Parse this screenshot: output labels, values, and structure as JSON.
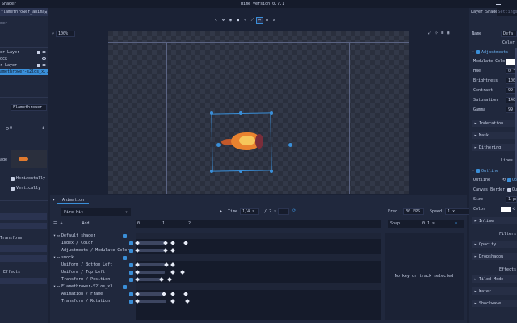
{
  "app": {
    "title": "Mime version 0.7.1"
  },
  "left_panel": {
    "tab": "Shader",
    "doc_tab": "flamethrower_animatio...",
    "sub_label": "der",
    "layers": [
      {
        "name": "er Layer"
      },
      {
        "name": "ock"
      },
      {
        "name": "r Layer"
      },
      {
        "name": "amethrower-s2los_x..."
      }
    ],
    "texture_name": "Flamethrower-S2#",
    "frame_value": "0",
    "flip_horizontal": "Horizontally",
    "flip_vertical": "Vertically",
    "transform_label": "Transform",
    "effects_label": "Effects"
  },
  "viewport": {
    "zoom": "100%"
  },
  "timeline": {
    "tab": "Animation",
    "clip_name": "Fire hit",
    "time_label": "Time",
    "time_value": "1/4 s",
    "time_total": "/ 2 s",
    "fps_label": "Freq.",
    "fps_value": "30 FPS",
    "speed_label": "Speed",
    "speed_value": "1 x",
    "add_label": "Add",
    "snap_label": "Snap",
    "snap_value": "0.1 s",
    "ruler": [
      "0",
      "1",
      "2"
    ],
    "empty_message": "No key or track selected",
    "tracks": [
      {
        "label": "Default shader",
        "group": true
      },
      {
        "label": "Index / Color",
        "group": false
      },
      {
        "label": "Adjustments / Modulate Color",
        "group": false
      },
      {
        "label": "smock",
        "group": true
      },
      {
        "label": "Uniform / Bottom Left",
        "group": false
      },
      {
        "label": "Uniform / Top Left",
        "group": false
      },
      {
        "label": "Transform / Position",
        "group": false
      },
      {
        "label": "Flamethrower-S2los_x3",
        "group": true
      },
      {
        "label": "Animation / Frame",
        "group": false
      },
      {
        "label": "Transform / Rotation",
        "group": false
      }
    ]
  },
  "right_panel": {
    "tabs": [
      "Layer Shader",
      "Settings"
    ],
    "name_label": "Name",
    "name_value": "Defa",
    "color_label": "Color",
    "adjustments_head": "Adjustments",
    "props": [
      {
        "label": "Modulate Color",
        "value": ""
      },
      {
        "label": "Hue",
        "value": "0 °"
      },
      {
        "label": "Brightness",
        "value": "100 %"
      },
      {
        "label": "Contrast",
        "value": "99 %"
      },
      {
        "label": "Saturation",
        "value": "140 %"
      },
      {
        "label": "Gamma",
        "value": "99 %"
      }
    ],
    "indexation": "Indexation",
    "mask": "Mask",
    "dithering": "Dithering",
    "lines_head": "Lines",
    "outline_head": "Outline",
    "outline_label": "Outline",
    "outline_value": "Op",
    "canvas_border_label": "Canvas Border",
    "canvas_border_value": "Ou",
    "size_label": "Size",
    "size_value": "1 px",
    "line_color_label": "Color",
    "inline": "Inline",
    "filters_head": "Filters",
    "opacity": "Opacity",
    "dropshadow": "Dropshadow",
    "effects_head": "Effects",
    "tiled_mode": "Tiled Mode",
    "water": "Water",
    "shockwave": "Shockwave"
  },
  "colors": {
    "accent": "#3a8fd9",
    "canvas_checker_dark": "#2a2f3d",
    "canvas_checker_light": "#323848"
  }
}
